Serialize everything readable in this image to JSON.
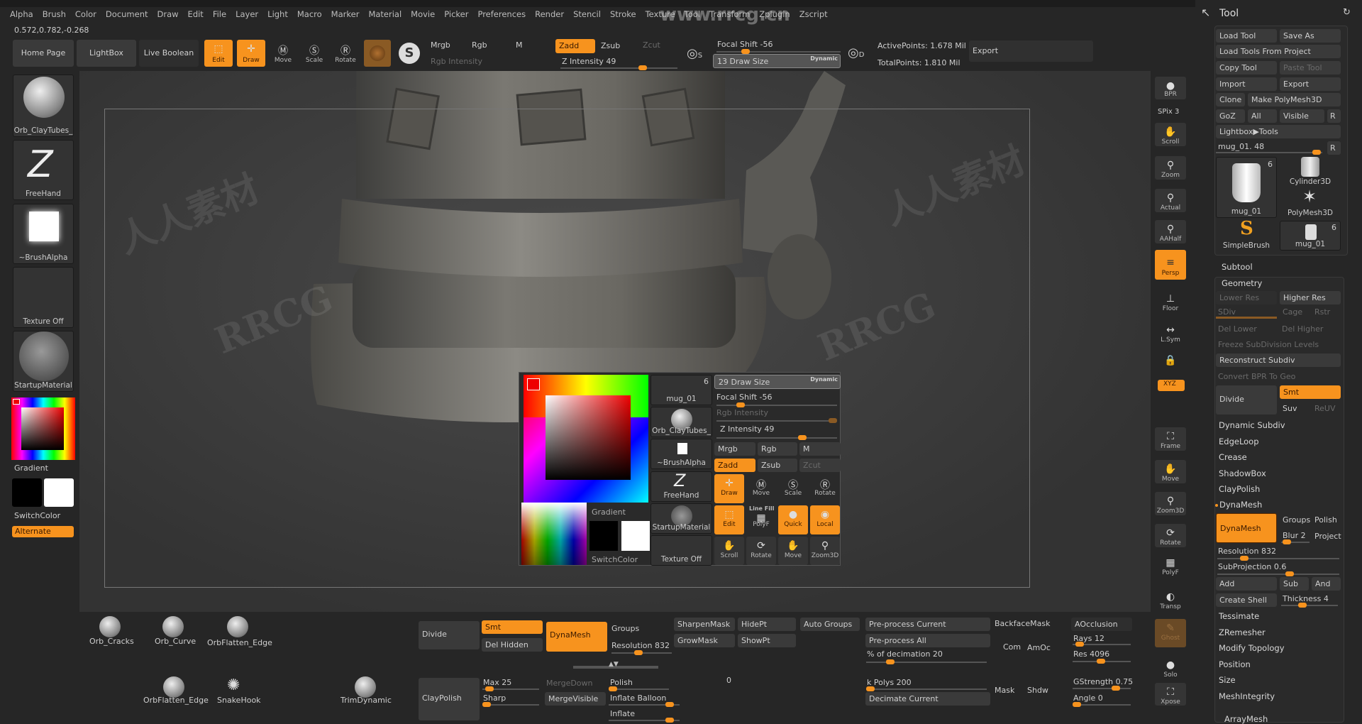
{
  "menu": [
    "Alpha",
    "Brush",
    "Color",
    "Document",
    "Draw",
    "Edit",
    "File",
    "Layer",
    "Light",
    "Macro",
    "Marker",
    "Material",
    "Movie",
    "Picker",
    "Preferences",
    "Render",
    "Stencil",
    "Stroke",
    "Texture",
    "Tool",
    "Transform",
    "Zplugin",
    "Zscript"
  ],
  "coords": "0.572,0.782,-0.268",
  "toolbar": {
    "home": "Home Page",
    "lightbox": "LightBox",
    "live_boolean": "Live Boolean",
    "edit": "Edit",
    "draw": "Draw",
    "move": "Move",
    "scale": "Scale",
    "rotate": "Rotate",
    "mrgb": "Mrgb",
    "rgb": "Rgb",
    "m": "M",
    "zadd": "Zadd",
    "zsub": "Zsub",
    "zcut": "Zcut",
    "rgb_intensity": "Rgb Intensity",
    "z_intensity": "Z Intensity 49",
    "focal_shift": "Focal Shift -56",
    "draw_size": "13 Draw Size",
    "dynamic": "Dynamic",
    "active_points": "ActivePoints: 1.678 Mil",
    "total_points": "TotalPoints: 1.810 Mil",
    "export": "Export",
    "s_label": "S",
    "d_label": "D"
  },
  "left_shelf": {
    "brush": "Orb_ClayTubes_",
    "stroke": "FreeHand",
    "alpha": "~BrushAlpha",
    "texture": "Texture Off",
    "material": "StartupMaterial",
    "gradient": "Gradient",
    "switch_color": "SwitchColor",
    "alternate": "Alternate",
    "main_color": "#e00000"
  },
  "right_shelf": {
    "bpr": "BPR",
    "spix": "SPix 3",
    "scroll": "Scroll",
    "zoom": "Zoom",
    "actual": "Actual",
    "aahalf": "AAHalf",
    "persp": "Persp",
    "floor": "Floor",
    "lsym": "L.Sym",
    "xyz": "XYZ",
    "frame": "Frame",
    "move": "Move",
    "zoom3d": "Zoom3D",
    "rotate": "Rotate",
    "polyf": "PolyF",
    "transp": "Transp",
    "ghost": "Ghost",
    "solo": "Solo",
    "xpose": "Xpose"
  },
  "tool_panel": {
    "title": "Tool",
    "load_tool": "Load Tool",
    "save_as": "Save As",
    "load_from_project": "Load Tools From Project",
    "copy_tool": "Copy Tool",
    "paste_tool": "Paste Tool",
    "import": "Import",
    "export": "Export",
    "clone": "Clone",
    "make_polymesh": "Make PolyMesh3D",
    "goz": "GoZ",
    "all": "All",
    "visible": "Visible",
    "r": "R",
    "lightbox_tools": "Lightbox▶Tools",
    "tool_slider": "mug_01. 48",
    "thumbs": [
      {
        "label": "mug_01",
        "count": "6"
      },
      {
        "label": "Cylinder3D"
      },
      {
        "label": "PolyMesh3D"
      },
      {
        "label": "SimpleBrush"
      },
      {
        "label": "mug_01",
        "count": "6"
      }
    ],
    "subtool": "Subtool",
    "geometry": "Geometry",
    "lower_res": "Lower Res",
    "higher_res": "Higher Res",
    "sdiv": "SDiv",
    "cage": "Cage",
    "rstr": "Rstr",
    "del_lower": "Del Lower",
    "del_higher": "Del Higher",
    "freeze": "Freeze SubDivision Levels",
    "reconstruct": "Reconstruct Subdiv",
    "convert_bpr": "Convert BPR To Geo",
    "divide": "Divide",
    "smt": "Smt",
    "suv": "Suv",
    "reuv": "ReUV",
    "items": [
      "Dynamic Subdiv",
      "EdgeLoop",
      "Crease",
      "ShadowBox",
      "ClayPolish"
    ],
    "dynamesh_header": "DynaMesh",
    "dynamesh_btn": "DynaMesh",
    "groups": "Groups",
    "polish": "Polish",
    "blur": "Blur 2",
    "project": "Project",
    "resolution": "Resolution 832",
    "subprojection": "SubProjection 0.6",
    "add": "Add",
    "sub": "Sub",
    "and": "And",
    "create_shell": "Create Shell",
    "thickness": "Thickness 4",
    "items2": [
      "Tessimate",
      "ZRemesher",
      "Modify Topology",
      "Position",
      "Size",
      "MeshIntegrity"
    ],
    "arraymesh": "ArrayMesh"
  },
  "popup": {
    "draw_size": "29 Draw Size",
    "dynamic": "Dynamic",
    "focal_shift": "Focal Shift -56",
    "rgb_intensity": "Rgb Intensity",
    "z_intensity": "Z Intensity 49",
    "mrgb": "Mrgb",
    "rgb": "Rgb",
    "m": "M",
    "zadd": "Zadd",
    "zsub": "Zsub",
    "zcut": "Zcut",
    "draw": "Draw",
    "move": "Move",
    "scale": "Scale",
    "rotate": "Rotate",
    "edit": "Edit",
    "polyf": "PolyF",
    "linefill": "Line Fill",
    "quick": "Quick",
    "local": "Local",
    "scroll": "Scroll",
    "rotate2": "Rotate",
    "move2": "Move",
    "zoom3d": "Zoom3D",
    "tool": "mug_01",
    "tool_count": "6",
    "brush": "Orb_ClayTubes_",
    "alpha": "~BrushAlpha",
    "stroke": "FreeHand",
    "material": "StartupMaterial",
    "texture": "Texture Off",
    "gradient": "Gradient",
    "switch_color": "SwitchColor"
  },
  "bottom": {
    "brushes": [
      "Orb_Cracks",
      "Orb_Curve",
      "OrbFlatten_Edge",
      "OrbFlatten_Edge",
      "SnakeHook",
      "TrimDynamic"
    ],
    "divide": "Divide",
    "smt": "Smt",
    "del_hidden": "Del Hidden",
    "dynamesh": "DynaMesh",
    "groups": "Groups",
    "resolution": "Resolution 832",
    "sharpen_mask": "SharpenMask",
    "grow_mask": "GrowMask",
    "hidept": "HidePt",
    "showpt": "ShowPt",
    "auto_groups": "Auto Groups",
    "preprocess_current": "Pre-process Current",
    "preprocess_all": "Pre-process All",
    "decimation": "% of decimation 20",
    "backface": "BackfaceMask",
    "com": "Com",
    "amoc": "AmOc",
    "aocclusion": "AOcclusion",
    "rays": "Rays 12",
    "res": "Res 4096",
    "claypolish": "ClayPolish",
    "max": "Max 25",
    "sharp": "Sharp",
    "mergedown": "MergeDown",
    "mergevisible": "MergeVisible",
    "polish": "Polish",
    "inflate_balloon": "Inflate Balloon",
    "inflate": "Inflate",
    "kpolys": "k Polys 200",
    "decimate_current": "Decimate Current",
    "mask": "Mask",
    "shdw": "Shdw",
    "gstrength": "GStrength 0.75",
    "angle": "Angle 0",
    "zero": "0"
  },
  "watermarks": [
    "www.rrcg.cn",
    "RRCG",
    "人人素材"
  ],
  "colors": {
    "accent": "#f7931e",
    "panel": "#3a3a3a",
    "background": "#262626"
  }
}
